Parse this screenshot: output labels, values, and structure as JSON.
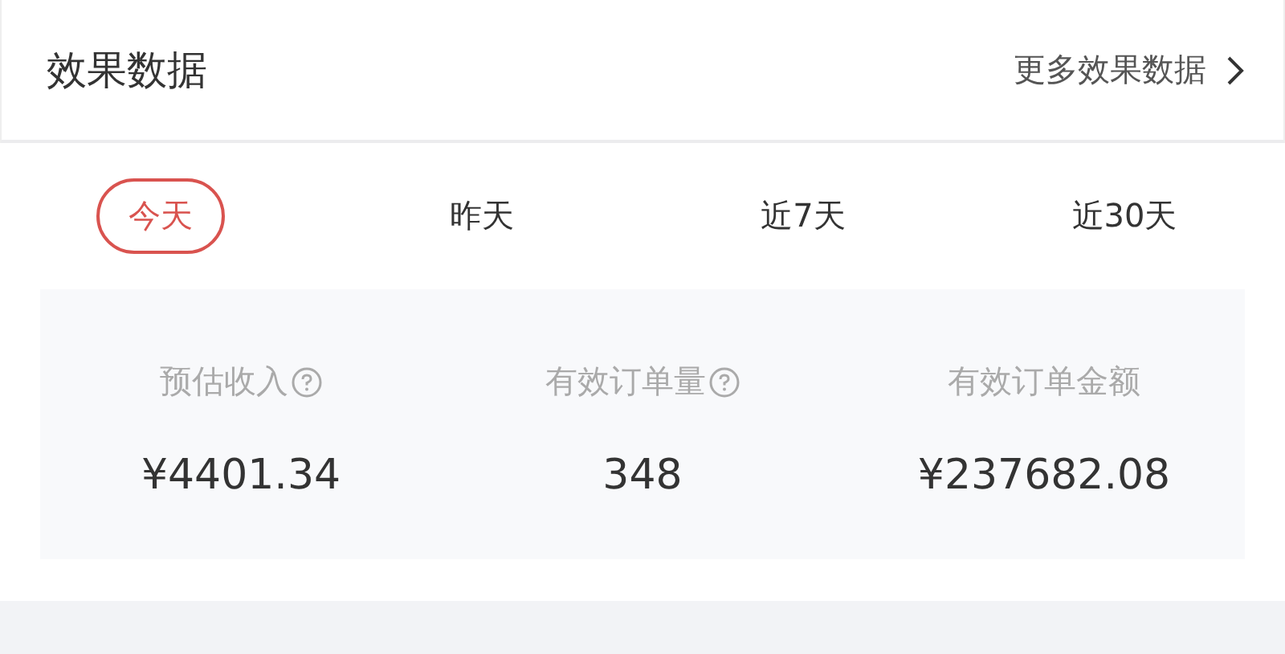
{
  "header": {
    "title": "效果数据",
    "more_link": "更多效果数据"
  },
  "tabs": [
    {
      "label": "今天",
      "selected": true
    },
    {
      "label": "昨天",
      "selected": false
    },
    {
      "label": "近7天",
      "selected": false
    },
    {
      "label": "近30天",
      "selected": false
    }
  ],
  "stats": [
    {
      "label": "预估收入",
      "help": true,
      "value": "¥4401.34"
    },
    {
      "label": "有效订单量",
      "help": true,
      "value": "348"
    },
    {
      "label": "有效订单金额",
      "help": false,
      "value": "¥237682.08"
    }
  ]
}
